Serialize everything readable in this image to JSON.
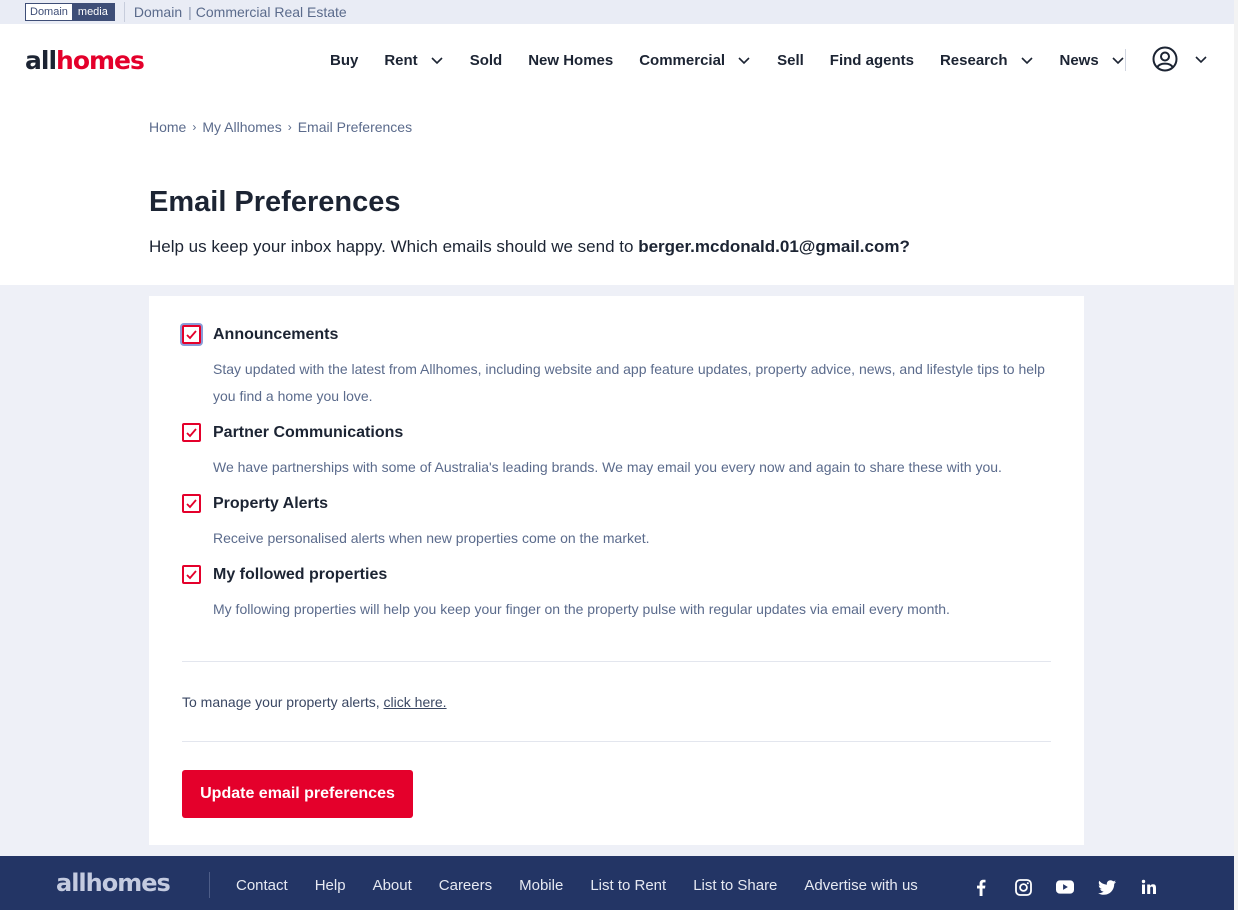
{
  "topbar": {
    "badge_left": "Domain",
    "badge_right": "media",
    "link_domain": "Domain",
    "link_commercial": "Commercial Real Estate"
  },
  "header": {
    "logo_all": "all",
    "logo_homes": "homes",
    "nav": [
      {
        "label": "Buy",
        "dropdown": false
      },
      {
        "label": "Rent",
        "dropdown": true
      },
      {
        "label": "Sold",
        "dropdown": false
      },
      {
        "label": "New Homes",
        "dropdown": false
      },
      {
        "label": "Commercial",
        "dropdown": true
      },
      {
        "label": "Sell",
        "dropdown": false
      },
      {
        "label": "Find agents",
        "dropdown": false
      },
      {
        "label": "Research",
        "dropdown": true
      },
      {
        "label": "News",
        "dropdown": true
      }
    ]
  },
  "breadcrumb": [
    "Home",
    "My Allhomes",
    "Email Preferences"
  ],
  "page": {
    "title": "Email Preferences",
    "intro": "Help us keep your inbox happy. Which emails should we send to ",
    "email": "berger.mcdonald.01@gmail.com?"
  },
  "preferences": [
    {
      "title": "Announcements",
      "checked": true,
      "description": "Stay updated with the latest from Allhomes, including website and app feature updates, property advice, news, and lifestyle tips to help you find a home you love."
    },
    {
      "title": "Partner Communications",
      "checked": true,
      "description": "We have partnerships with some of Australia's leading brands. We may email you every now and again to share these with you."
    },
    {
      "title": "Property Alerts",
      "checked": true,
      "description": "Receive personalised alerts when new properties come on the market."
    },
    {
      "title": "My followed properties",
      "checked": true,
      "description": "My following properties will help you keep your finger on the property pulse with regular updates via email every month."
    }
  ],
  "manage": {
    "text": "To manage your property alerts, ",
    "link": "click here."
  },
  "update_button": "Update email preferences",
  "footer": {
    "logo": "allhomes",
    "links": [
      "Contact",
      "Help",
      "About",
      "Careers",
      "Mobile",
      "List to Rent",
      "List to Share",
      "Advertise with us"
    ],
    "social": [
      "facebook-icon",
      "instagram-icon",
      "youtube-icon",
      "twitter-icon",
      "linkedin-icon"
    ]
  },
  "colors": {
    "brand_red": "#e4002b",
    "navy": "#233565",
    "text": "#1c2433",
    "muted": "#5b6b8c"
  }
}
